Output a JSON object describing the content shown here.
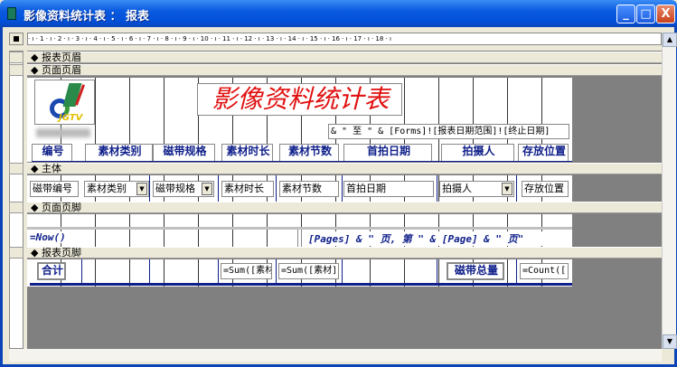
{
  "window": {
    "title": "影像资料统计表 ： 报表"
  },
  "ruler": {
    "marks": "· ı · 1 · ı · 2 · ı · 3 · ı · 4 · ı · 5 · ı · 6 · ı · 7 · ı · 8 · ı · 9 · ı · 10 · ı · 11 · ı · 12 · ı · 13 · ı · 14 · ı · 15 · ı · 16 · ı · 17 · ı · 18 · ı"
  },
  "sections": {
    "report_header": "报表页眉",
    "page_header": "页面页眉",
    "detail": "主体",
    "page_footer": "页面页脚",
    "report_footer": "报表页脚"
  },
  "page_header": {
    "logo_text": "JGTV",
    "title": "影像资料统计表",
    "date_expr": "& \" 至 \" & [Forms]![报表日期范围]![终止日期]",
    "labels": [
      "编号",
      "素材类别",
      "磁带规格",
      "素材时长",
      "素材节数",
      "首拍日期",
      "拍摄人",
      "存放位置"
    ]
  },
  "detail": {
    "fields": [
      "磁带编号",
      "素材类别",
      "磁带规格",
      "素材时长",
      "素材节数",
      "首拍日期",
      "拍摄人",
      "存放位置"
    ]
  },
  "page_footer": {
    "now": "=Now()",
    "pages": "[Pages] & \" 页, 第 \" & [Page] & \" 页\""
  },
  "report_footer": {
    "total_label": "合计",
    "sum1": "=Sum([素材",
    "sum2": "=Sum([素材]",
    "tape_total_label": "磁带总量",
    "count": "=Count([("
  }
}
